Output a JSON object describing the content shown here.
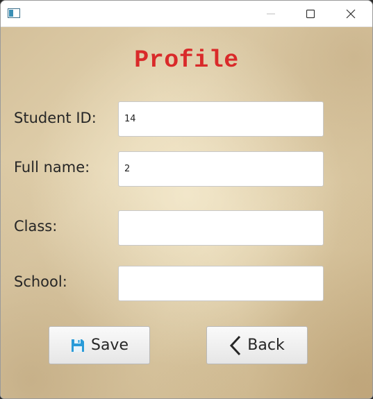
{
  "titlebar": {
    "icons": {
      "app": "app-window-icon",
      "minimize": "minimize-icon",
      "maximize": "maximize-icon",
      "close": "close-icon"
    }
  },
  "form": {
    "title": "Profile",
    "title_color": "#d92a2a",
    "fields": [
      {
        "label": "Student ID:",
        "value": "14"
      },
      {
        "label": "Full name:",
        "value": "2"
      },
      {
        "label": "Class:",
        "value": ""
      },
      {
        "label": "School:",
        "value": ""
      }
    ]
  },
  "actions": {
    "save_label": "Save",
    "save_icon": "floppy-disk-icon",
    "save_icon_color": "#2a9bd8",
    "back_label": "Back",
    "back_icon": "chevron-left-icon"
  }
}
